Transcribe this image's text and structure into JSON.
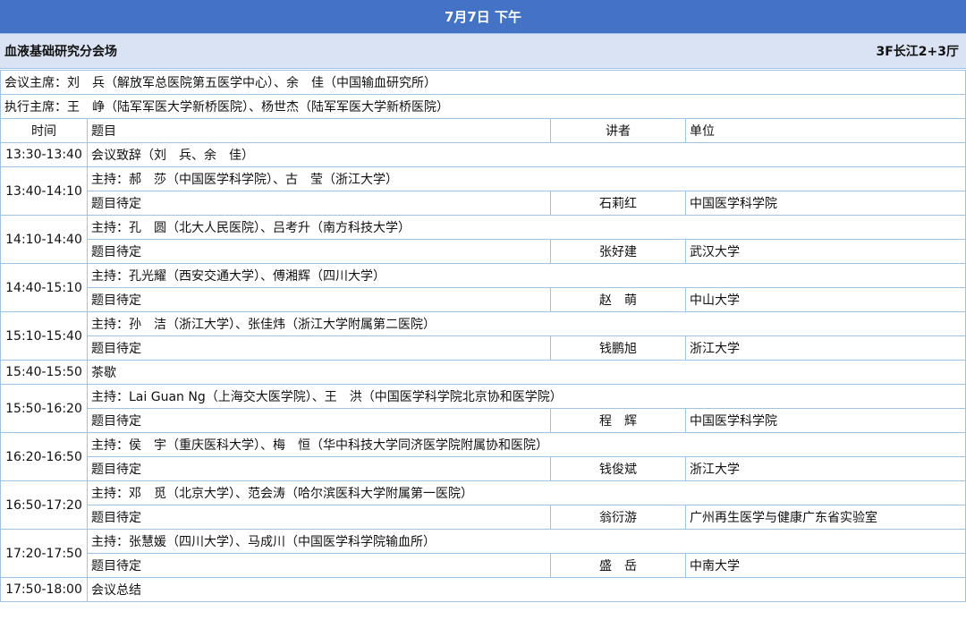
{
  "banner": "7月7日  下午",
  "venue": {
    "name": "血液基础研究分会场",
    "room": "3F长江2+3厅"
  },
  "chairs": {
    "session": "会议主席：刘　兵（解放军总医院第五医学中心）、余　佳（中国输血研究所）",
    "executive": "执行主席：王　峥（陆军军医大学新桥医院）、杨世杰（陆军军医大学新桥医院）"
  },
  "columns": {
    "time": "时间",
    "topic": "题目",
    "speaker": "讲者",
    "unit": "单位"
  },
  "rows": [
    {
      "time": "13:30-13:40",
      "text": "会议致辞（刘　兵、余　佳）"
    },
    {
      "time": "13:40-14:10",
      "host": "主持：郝　莎（中国医学科学院）、古　莹（浙江大学）",
      "topic": "题目待定",
      "speaker": "石莉红",
      "unit": "中国医学科学院"
    },
    {
      "time": "14:10-14:40",
      "host": "主持：孔　圆（北大人民医院）、吕考升（南方科技大学）",
      "topic": "题目待定",
      "speaker": "张好建",
      "unit": "武汉大学"
    },
    {
      "time": "14:40-15:10",
      "host": "主持：孔光耀（西安交通大学）、傅湘辉（四川大学）",
      "topic": "题目待定",
      "speaker": "赵　萌",
      "unit": "中山大学"
    },
    {
      "time": "15:10-15:40",
      "host": "主持：孙　洁（浙江大学）、张佳炜（浙江大学附属第二医院）",
      "topic": "题目待定",
      "speaker": "钱鹏旭",
      "unit": "浙江大学"
    },
    {
      "time": "15:40-15:50",
      "text": "茶歇"
    },
    {
      "time": "15:50-16:20",
      "host": "主持：Lai Guan Ng（上海交大医学院）、王　洪（中国医学科学院北京协和医学院）",
      "topic": "题目待定",
      "speaker": "程　辉",
      "unit": "中国医学科学院"
    },
    {
      "time": "16:20-16:50",
      "host": "主持：侯　宇（重庆医科大学）、梅　恒（华中科技大学同济医学院附属协和医院）",
      "topic": "题目待定",
      "speaker": "钱俊斌",
      "unit": "浙江大学"
    },
    {
      "time": "16:50-17:20",
      "host": "主持：邓　觅（北京大学）、范会涛（哈尔滨医科大学附属第一医院）",
      "topic": "题目待定",
      "speaker": "翁衍游",
      "unit": "广州再生医学与健康广东省实验室"
    },
    {
      "time": "17:20-17:50",
      "host": "主持：张慧媛（四川大学）、马成川（中国医学科学院输血所）",
      "topic": "题目待定",
      "speaker": "盛　岳",
      "unit": "中南大学"
    },
    {
      "time": "17:50-18:00",
      "text": "会议总结"
    }
  ]
}
